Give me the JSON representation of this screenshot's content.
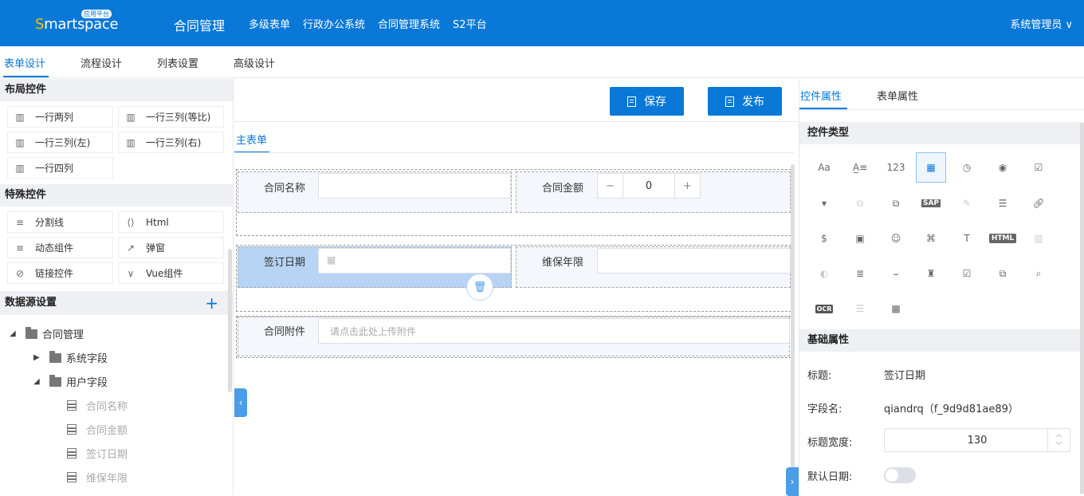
{
  "header": {
    "logo_text": "Smartspace",
    "logo_badge": "应用平台",
    "title": "合同管理",
    "nav": [
      "多级表单",
      "行政办公系统",
      "合同管理系统",
      "S2平台"
    ],
    "user": "系统管理员"
  },
  "tabs": [
    "表单设计",
    "流程设计",
    "列表设置",
    "高级设计"
  ],
  "left": {
    "layout_title": "布局控件",
    "layout_items": [
      "一行两列",
      "一行三列(等比)",
      "一行三列(左)",
      "一行三列(右)",
      "一行四列"
    ],
    "special_title": "特殊控件",
    "special_items": [
      "分割线",
      "Html",
      "动态组件",
      "弹窗",
      "链接控件",
      "Vue组件"
    ],
    "datasource_title": "数据源设置",
    "tree": {
      "root": "合同管理",
      "system": "系统字段",
      "user": "用户字段",
      "fields": [
        "合同名称",
        "合同金额",
        "签订日期",
        "维保年限"
      ]
    }
  },
  "center": {
    "save": "保存",
    "publish": "发布",
    "subtab": "主表单",
    "f_name": "合同名称",
    "f_amount": "合同金额",
    "amount_value": "0",
    "f_date": "签订日期",
    "f_years": "维保年限",
    "f_attach": "合同附件",
    "attach_placeholder": "请点击此处上传附件"
  },
  "right": {
    "tab_ctrl": "控件属性",
    "tab_form": "表单属性",
    "type_title": "控件类型",
    "base_title": "基础属性",
    "label_title": "标题:",
    "title_value": "签订日期",
    "label_field": "字段名:",
    "field_value": "qiandrq（f_9d9d81ae89）",
    "label_width": "标题宽度:",
    "width_value": "130",
    "label_default": "默认日期:",
    "icon_texts": {
      "aa": "Aa",
      "num": "123",
      "sap": "SAP",
      "html": "HTML",
      "ocr": "OCR"
    }
  }
}
